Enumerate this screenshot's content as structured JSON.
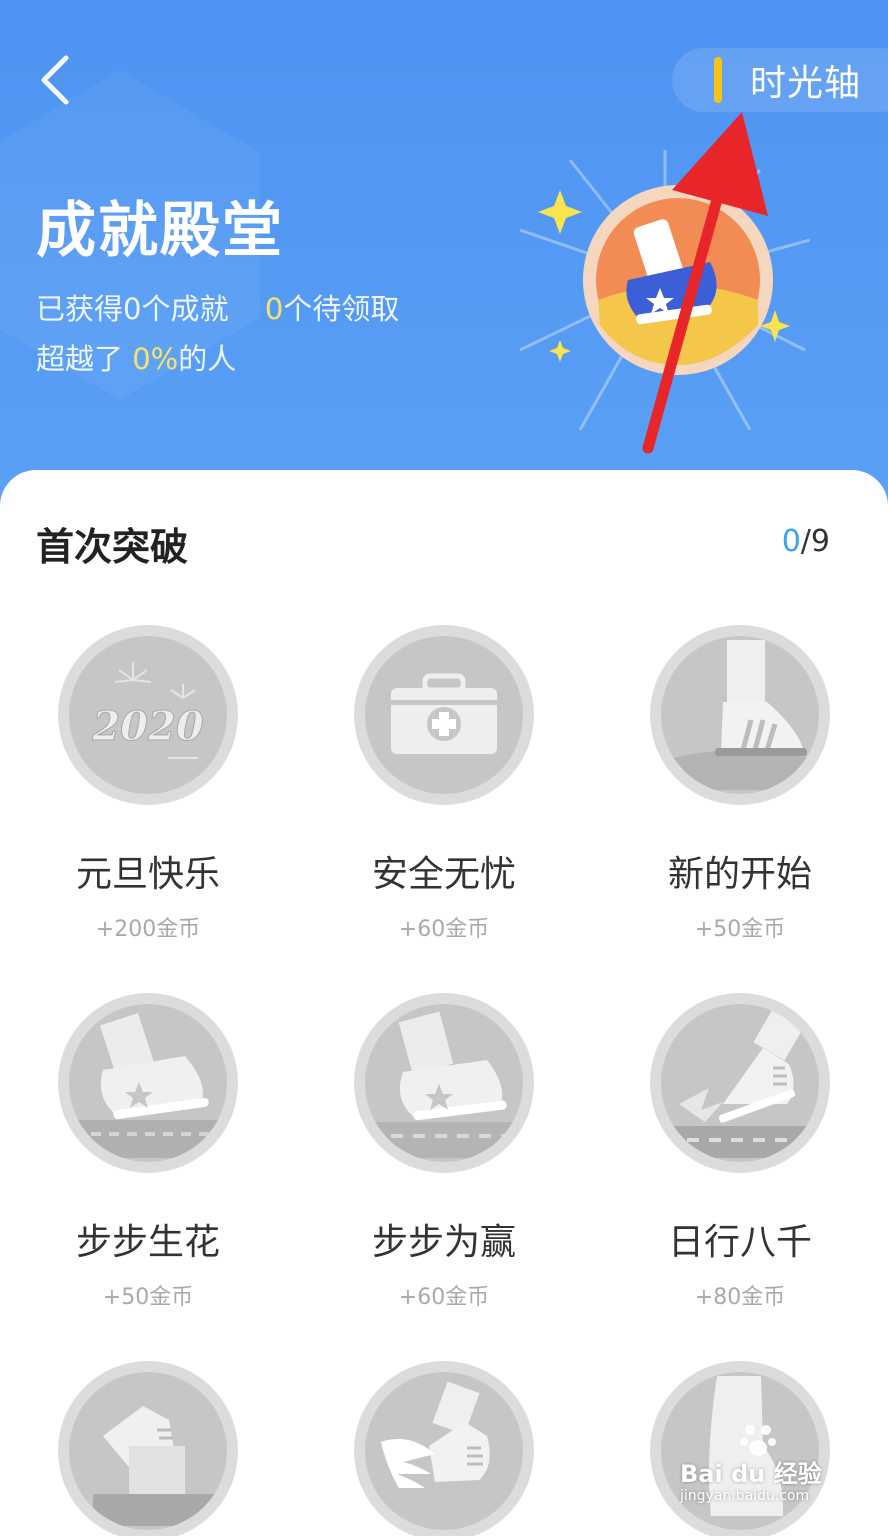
{
  "header": {
    "title": "成就殿堂",
    "timeline_label": "时光轴",
    "stat_prefix": "已获得0个成就",
    "pending_value": "0",
    "pending_suffix": "个待领取",
    "surpass_prefix": "超越了",
    "surpass_value": "0%",
    "surpass_suffix": "的人"
  },
  "section": {
    "title": "首次突破",
    "count_current": "0",
    "count_total": "/9"
  },
  "achievements": [
    {
      "name": "元旦快乐",
      "reward": "+200金币",
      "icon": "new-year-2020-icon"
    },
    {
      "name": "安全无忧",
      "reward": "+60金币",
      "icon": "first-aid-kit-icon"
    },
    {
      "name": "新的开始",
      "reward": "+50金币",
      "icon": "slipper-foot-icon"
    },
    {
      "name": "步步生花",
      "reward": "+50金币",
      "icon": "sneaker-step-icon"
    },
    {
      "name": "步步为赢",
      "reward": "+60金币",
      "icon": "sneaker-win-icon"
    },
    {
      "name": "日行八千",
      "reward": "+80金币",
      "icon": "running-shoe-icon"
    },
    {
      "name": "",
      "reward": "",
      "icon": "high-shoe-icon"
    },
    {
      "name": "",
      "reward": "",
      "icon": "winged-shoe-icon"
    },
    {
      "name": "",
      "reward": "",
      "icon": "bare-foot-icon"
    }
  ],
  "watermark": {
    "brand": "Bai du 经验",
    "url": "jingyan.baidu.com"
  },
  "colors": {
    "header_blue": "#4f96f3",
    "highlight_yellow": "#f7e36a",
    "count_blue": "#39a4f0",
    "annotation_red": "#e8262a"
  }
}
